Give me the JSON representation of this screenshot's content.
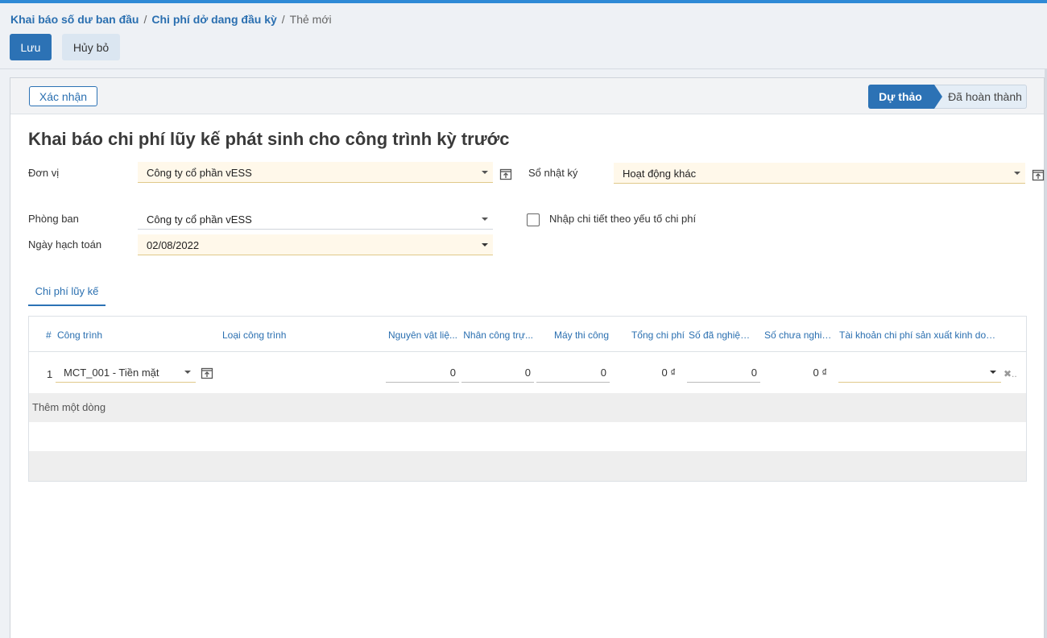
{
  "breadcrumb": {
    "item1": "Khai báo số dư ban đầu",
    "item2": "Chi phí dở dang đầu kỳ",
    "current": "Thẻ mới",
    "separator": "/"
  },
  "toolbar": {
    "save_label": "Lưu",
    "cancel_label": "Hủy bỏ"
  },
  "statusbar": {
    "confirm_label": "Xác nhận",
    "stages": {
      "draft": "Dự thảo",
      "done": "Đã hoàn thành"
    },
    "active_stage": "Dự thảo"
  },
  "form": {
    "title": "Khai báo chi phí lũy kế phát sinh cho công trình kỳ trước",
    "don_vi": {
      "label": "Đơn vị",
      "value": "Công ty cổ phần vESS"
    },
    "so_nhat_ky": {
      "label": "Sổ nhật ký",
      "value": "Hoạt động khác"
    },
    "phong_ban": {
      "label": "Phòng ban",
      "value": "Công ty cổ phần vESS"
    },
    "ngay_hach_toan": {
      "label": "Ngày hạch toán",
      "value": "02/08/2022"
    },
    "nhap_chi_tiet": {
      "label": "Nhập chi tiết theo yếu tố chi phí",
      "checked": false
    }
  },
  "tabs": [
    {
      "label": "Chi phí lũy kế",
      "active": true
    }
  ],
  "table": {
    "headers": {
      "num": "#",
      "cong_trinh": "Công trình",
      "loai_cong_trinh": "Loại công trình",
      "nguyen_vat_lieu": "Nguyên vật liệ...",
      "nhan_cong": "Nhân công trự...",
      "may_thi_cong": "Máy thi công",
      "tong_chi_phi": "Tổng chi phí",
      "so_da_nghiem_thu": "Số đã nghiệm ...",
      "so_chua_nghiem_thu": "Số chưa nghiệ...",
      "tai_khoan": "Tài khoản chi phí sản xuất kinh doan..."
    },
    "rows": [
      {
        "num": "1",
        "cong_trinh": "MCT_001 - Tiền mặt",
        "loai_cong_trinh": "",
        "nguyen_vat_lieu": "0",
        "nhan_cong": "0",
        "may_thi_cong": "0",
        "tong_chi_phi": "0 ₫",
        "so_da_nghiem_thu": "0",
        "so_chua_nghiem_thu": "0 ₫",
        "tai_khoan": ""
      }
    ],
    "add_line": "Thêm một dòng"
  },
  "colors": {
    "primary": "#2c72b5",
    "link": "#2a6fb0",
    "required_field_bg": "#fff8ea",
    "top_accent": "#2f8ad6"
  }
}
